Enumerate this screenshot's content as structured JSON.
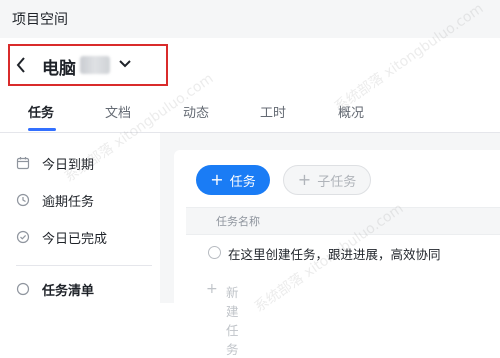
{
  "topbar": {
    "title": "项目空间"
  },
  "project": {
    "name": "电脑"
  },
  "tabs": [
    {
      "label": "任务",
      "active": true
    },
    {
      "label": "文档",
      "active": false
    },
    {
      "label": "动态",
      "active": false
    },
    {
      "label": "工时",
      "active": false
    },
    {
      "label": "概况",
      "active": false
    }
  ],
  "sidebar": {
    "items": [
      {
        "label": "今日到期",
        "icon": "calendar-icon"
      },
      {
        "label": "逾期任务",
        "icon": "clock-icon"
      },
      {
        "label": "今日已完成",
        "icon": "check-circle-icon"
      },
      {
        "label": "任务清单",
        "icon": "list-icon"
      }
    ]
  },
  "toolbar": {
    "add_task_label": "任务",
    "add_subtask_label": "子任务"
  },
  "table": {
    "column_header": "任务名称",
    "placeholder_task": "在这里创建任务，跟进进展，高效协同",
    "new_task_label": "新建任务"
  },
  "watermark": {
    "text": "系统部落 xitongbuluo.com"
  },
  "colors": {
    "accent": "#1a7cf5",
    "tab_underline": "#3370ff",
    "highlight_box": "#d92b2b"
  }
}
